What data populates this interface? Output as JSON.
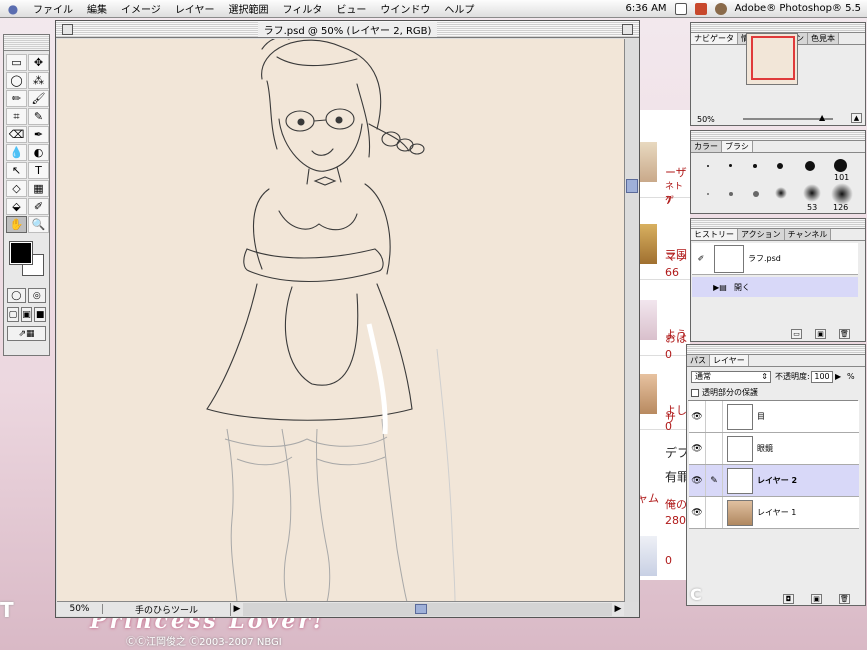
{
  "menubar": {
    "items": [
      "ファイル",
      "編集",
      "イメージ",
      "レイヤー",
      "選択範囲",
      "フィルタ",
      "ビュー",
      "ウインドウ",
      "ヘルプ"
    ],
    "time": "6:36 AM",
    "app_name": "Adobe® Photoshop® 5.5"
  },
  "document": {
    "title": "ラフ.psd @ 50% (レイヤー 2, RGB)",
    "zoom": "50%",
    "status_info": "手のひらツール"
  },
  "toolbox": {
    "tools": [
      "▭",
      "✥",
      "◯",
      "⁂",
      "✏",
      "🖌",
      "⌗",
      "✎",
      "⌫",
      "✒",
      "💧",
      "◐",
      "↖",
      "T",
      "◇",
      "▦",
      "⬙",
      "✐",
      "✋",
      "🔍"
    ]
  },
  "navigator": {
    "tabs": [
      "ナビゲータ",
      "情報",
      "オプション",
      "色見本"
    ],
    "zoom": "50%"
  },
  "brushes": {
    "tabs": [
      "カラー",
      "ブラシ"
    ],
    "labels": [
      "101",
      "53",
      "126"
    ]
  },
  "history": {
    "tabs": [
      "ヒストリー",
      "アクション",
      "チャンネル"
    ],
    "snapshot": "ラフ.psd",
    "steps": [
      "開く"
    ]
  },
  "layers": {
    "tabs": [
      "パス",
      "レイヤー"
    ],
    "blend_mode": "通常",
    "opacity_label": "不透明度:",
    "opacity_value": "100",
    "opacity_unit": "%",
    "preserve_transparency": "透明部分の保護",
    "items": [
      {
        "name": "目",
        "selected": false
      },
      {
        "name": "眼鏡",
        "selected": false
      },
      {
        "name": "レイヤー 2",
        "selected": true
      },
      {
        "name": "レイヤー 1",
        "selected": false
      }
    ]
  },
  "background_page": {
    "texts": [
      "ーザ",
      "ネトゲ",
      "7",
      "マッ",
      "三国",
      "66",
      "よう",
      "おは",
      "0",
      "サ",
      "よし",
      "0",
      "デフ",
      "有罪",
      "ャム",
      "俺の",
      "280",
      "0"
    ]
  },
  "footer": {
    "brand": "Princess Lover!",
    "copyright": "ⒸⒸ江岡俊之 Ⓒ2003-2007 NBGI"
  },
  "colors": {
    "canvas_bg": "#f2e6d8",
    "selection": "#d8d8f8",
    "scroll_thumb": "#9fb0d8",
    "nav_frame": "#e03a3a"
  }
}
